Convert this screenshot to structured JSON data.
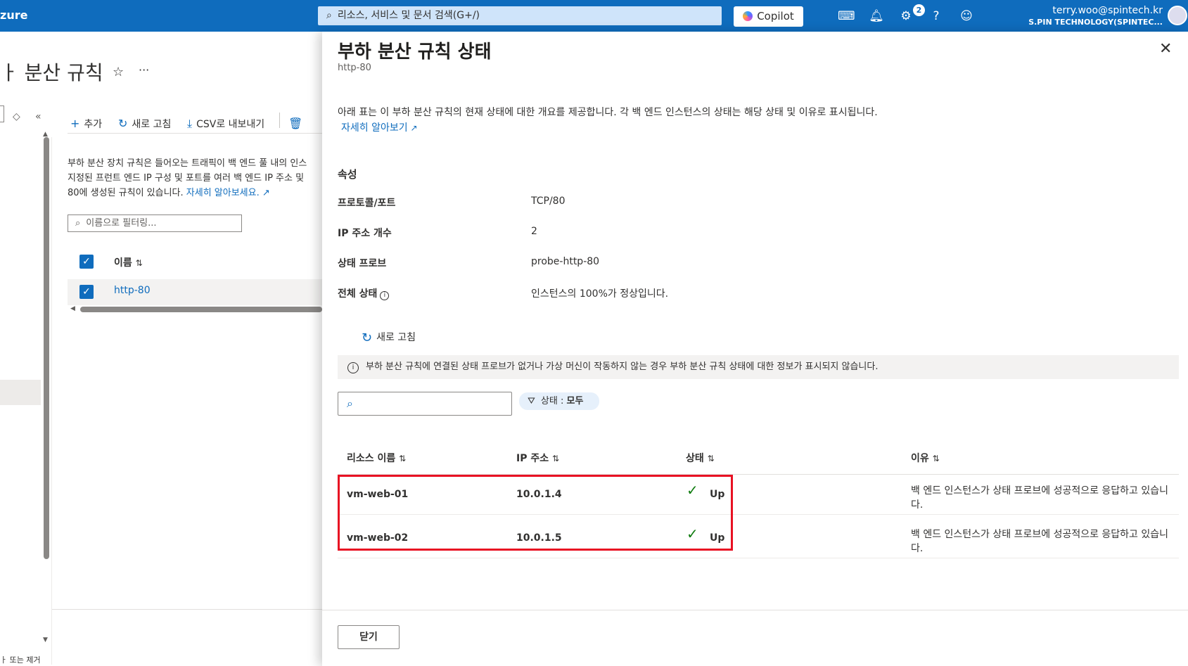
{
  "header": {
    "brand": "zure",
    "search_placeholder": "리소스, 서비스 및 문서 검색(G+/)",
    "copilot_label": "Copilot",
    "notification_count": "2",
    "user_email": "terry.woo@spintech.kr",
    "user_org": "S.PIN TECHNOLOGY(SPINTEC..."
  },
  "left_page": {
    "title": "ㅏ 분산 규칙",
    "toolbar": {
      "add": "추가",
      "refresh": "새로 고침",
      "export": "CSV로 내보내기"
    },
    "description_lines": [
      "부하 분산 장치 규칙은 들어오는 트래픽이 백 엔드 풀 내의 인스",
      "지정된 프런트 엔드 IP 구성 및 포트를 여러 백 엔드 IP 주소 및",
      "80에 생성된 규칙이 있습니다."
    ],
    "learn_more": "자세히 알아보세요.",
    "filter_placeholder": "이름으로 필터링...",
    "column_name": "이름",
    "row_name": "http-80",
    "bottom_text": "ㅏ 또는 제거"
  },
  "panel": {
    "title": "부하 분산 규칙 상태",
    "subtitle": "http-80",
    "description": "아래 표는 이 부하 분산 규칙의 현재 상태에 대한 개요를 제공합니다. 각 백 엔드 인스턴스의 상태는 해당 상태 및 이유로 표시됩니다.",
    "learn_more": "자세히 알아보기",
    "section_title": "속성",
    "properties": [
      {
        "label": "프로토콜/포트",
        "value": "TCP/80"
      },
      {
        "label": "IP 주소 개수",
        "value": "2"
      },
      {
        "label": "상태 프로브",
        "value": "probe-http-80"
      },
      {
        "label": "전체 상태",
        "value": "인스턴스의 100%가 정상입니다."
      }
    ],
    "refresh_label": "새로 고침",
    "banner": "부하 분산 규칙에 연결된 상태 프로브가 없거나 가상 머신이 작동하지 않는 경우 부하 분산 규칙 상태에 대한 정보가 표시되지 않습니다.",
    "filter_label": "상태 : ",
    "filter_value": "모두",
    "columns": [
      "리소스 이름",
      "IP 주소",
      "상태",
      "이유"
    ],
    "rows": [
      {
        "name": "vm-web-01",
        "ip": "10.0.1.4",
        "status": "Up",
        "reason_line1": "백 엔드 인스턴스가 상태 프로브에 성공적으로 응답하고 있습니",
        "reason_line2": "다."
      },
      {
        "name": "vm-web-02",
        "ip": "10.0.1.5",
        "status": "Up",
        "reason_line1": "백 엔드 인스턴스가 상태 프로브에 성공적으로 응답하고 있습니",
        "reason_line2": "다."
      }
    ],
    "close_button": "닫기"
  }
}
